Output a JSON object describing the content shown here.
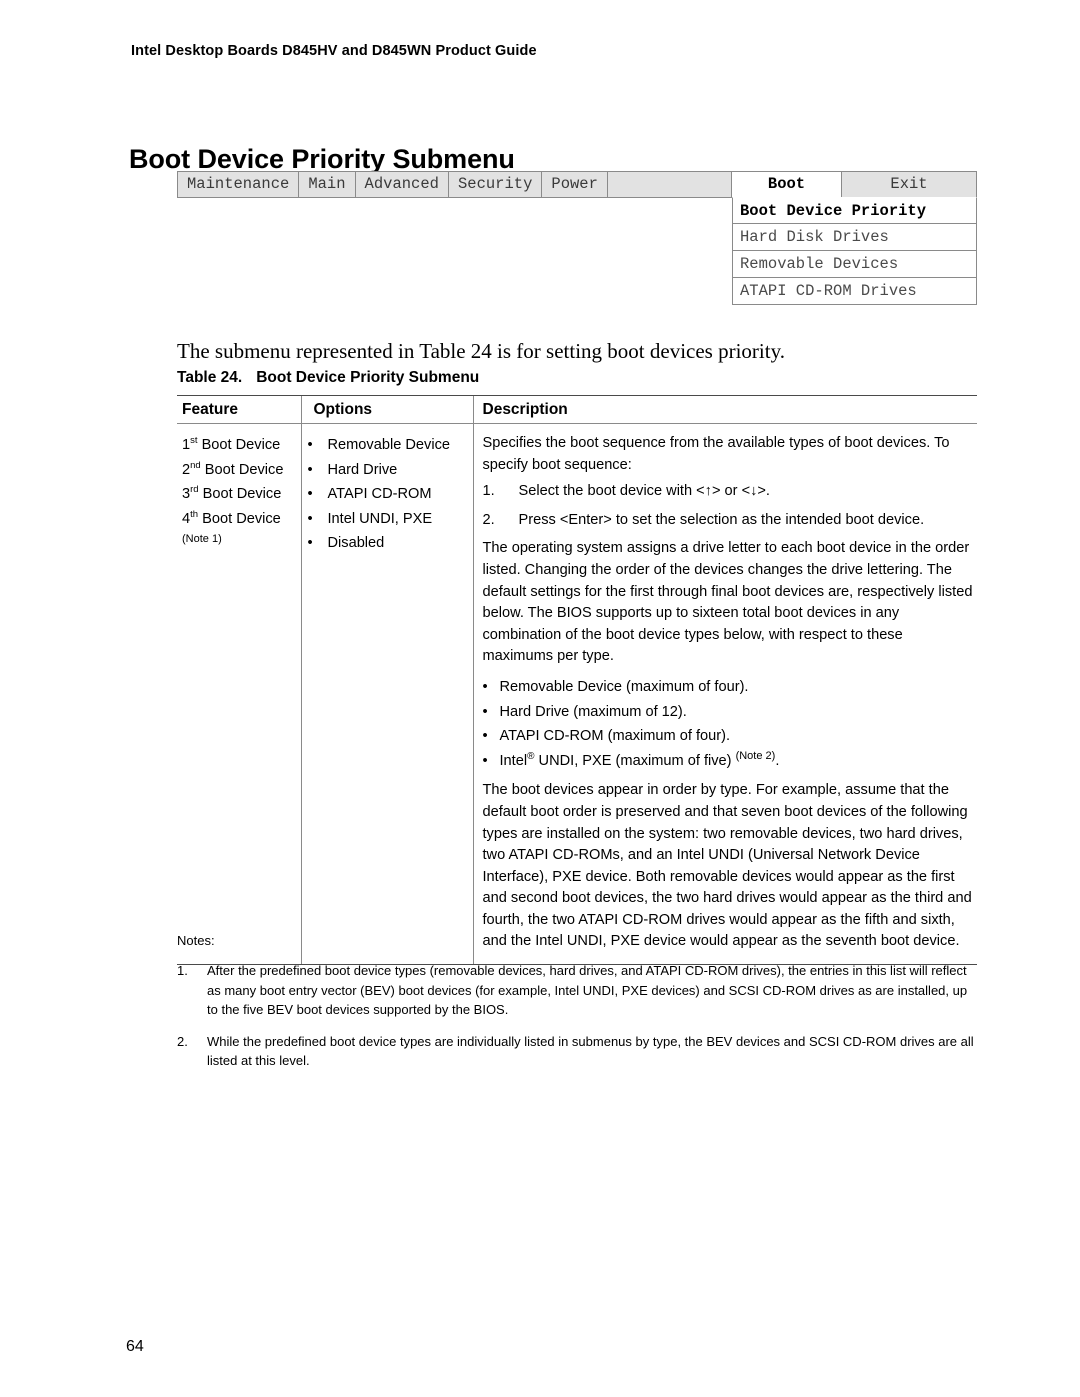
{
  "running_header": "Intel Desktop Boards D845HV and D845WN Product Guide",
  "page_title": "Boot Device Priority Submenu",
  "page_number": "64",
  "bios_menu": {
    "tabs": [
      {
        "label": "Maintenance",
        "active": false
      },
      {
        "label": "Main",
        "active": false
      },
      {
        "label": "Advanced",
        "active": false
      },
      {
        "label": "Security",
        "active": false
      },
      {
        "label": "Power",
        "active": false
      },
      {
        "label": "Boot",
        "active": true
      },
      {
        "label": "Exit",
        "active": false
      }
    ],
    "submenu_items": [
      {
        "label": "Boot Device Priority",
        "selected": true
      },
      {
        "label": "Hard Disk Drives",
        "selected": false
      },
      {
        "label": "Removable Devices",
        "selected": false
      },
      {
        "label": "ATAPI CD-ROM Drives",
        "selected": false
      }
    ]
  },
  "intro_text": "The submenu represented in Table 24 is for setting boot devices priority.",
  "table_caption": {
    "number": "Table 24.",
    "title": "Boot Device Priority Submenu"
  },
  "table": {
    "headers": [
      "Feature",
      "Options",
      "Description"
    ],
    "feature_rows": [
      {
        "ordinal": "1",
        "sup": "st",
        "text": " Boot Device"
      },
      {
        "ordinal": "2",
        "sup": "nd",
        "text": " Boot Device"
      },
      {
        "ordinal": "3",
        "sup": "rd",
        "text": " Boot Device"
      },
      {
        "ordinal": "4",
        "sup": "th",
        "text": " Boot Device"
      }
    ],
    "feature_note": "(Note 1)",
    "options": [
      "Removable Device",
      "Hard Drive",
      "ATAPI CD-ROM",
      "Intel UNDI, PXE",
      "Disabled"
    ],
    "description": {
      "intro": "Specifies the boot sequence from the available types of boot devices.  To specify boot sequence:",
      "steps": [
        {
          "num": "1.",
          "text": "Select the boot device with <↑> or <↓>."
        },
        {
          "num": "2.",
          "text": "Press <Enter> to set the selection as the intended boot device."
        }
      ],
      "paragraph_2": "The operating system assigns a drive letter to each boot device in the order listed.  Changing the order of the devices changes the drive lettering.  The default settings for the first through final boot devices are, respectively listed below.  The BIOS supports up to sixteen total boot devices in any combination of the boot device types below, with respect to these maximums per type.",
      "maximum_bullets": [
        {
          "pre": "Removable Device (maximum of four).",
          "reg": false,
          "note": ""
        },
        {
          "pre": "Hard Drive (maximum of 12).",
          "reg": false,
          "note": ""
        },
        {
          "pre": "ATAPI CD-ROM (maximum of four).",
          "reg": false,
          "note": ""
        },
        {
          "pre": "Intel",
          "reg": true,
          "post": " UNDI, PXE (maximum of five)",
          "note": "(Note 2)",
          "tail": "."
        }
      ],
      "paragraph_3": "The boot devices appear in order by type.  For example, assume that the default boot order is preserved and that seven boot devices of the following types are installed on the system:  two removable devices, two hard drives, two ATAPI CD-ROMs, and an Intel UNDI (Universal Network Device Interface), PXE device.  Both removable devices would appear as the first and second boot devices, the two hard drives would appear as the third and fourth, the two ATAPI CD-ROM drives would appear as the fifth and sixth, and the Intel UNDI, PXE device would appear as the seventh boot device."
    }
  },
  "notes": {
    "label": "Notes:",
    "items": [
      {
        "num": "1.",
        "text": "After the predefined boot device types (removable devices, hard drives, and ATAPI CD-ROM drives), the entries in this list will reflect as many boot entry vector (BEV) boot devices (for example, Intel UNDI, PXE devices) and SCSI CD-ROM drives as are installed, up to the five BEV boot devices supported by the BIOS."
      },
      {
        "num": "2.",
        "text": "While the predefined boot device types are individually listed in submenus by type, the BEV devices and SCSI CD-ROM drives are all listed at this level."
      }
    ]
  }
}
